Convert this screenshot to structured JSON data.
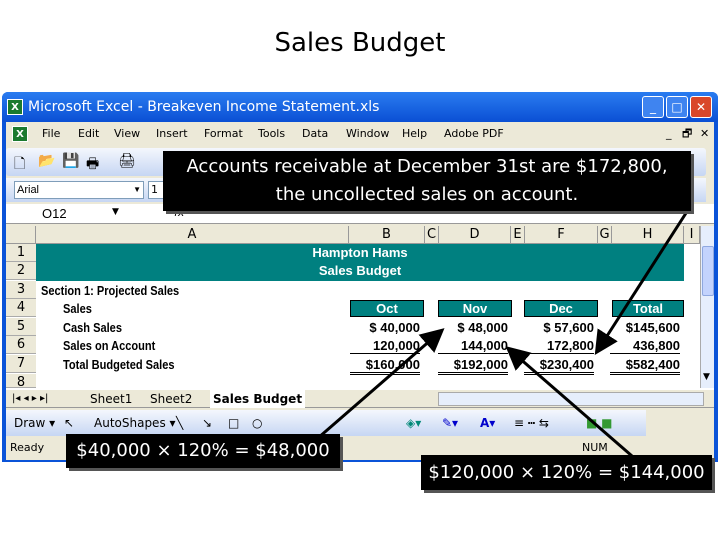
{
  "slide_title": "Sales Budget",
  "window": {
    "title": "Microsoft Excel - Breakeven Income Statement.xls"
  },
  "menu": [
    "File",
    "Edit",
    "View",
    "Insert",
    "Format",
    "Tools",
    "Data",
    "Window",
    "Help",
    "Adobe PDF"
  ],
  "format_bar": {
    "font": "Arial",
    "size": "1"
  },
  "formula_bar": {
    "name_box": "O12",
    "fx": "fx"
  },
  "columns": [
    "A",
    "B",
    "C",
    "D",
    "E",
    "F",
    "G",
    "H",
    "I"
  ],
  "rows": [
    "1",
    "2",
    "3",
    "4",
    "5",
    "6",
    "7",
    "8"
  ],
  "sheet": {
    "company": "Hampton Hams",
    "title": "Sales Budget",
    "section": "Section 1: Projected Sales",
    "labels": [
      "Sales",
      "Cash Sales",
      "Sales on Account",
      "Total Budgeted Sales"
    ],
    "months": [
      "Oct",
      "Nov",
      "Dec",
      "Total"
    ],
    "cash_sales": [
      "$  40,000",
      "$  48,000",
      "$  57,600",
      "$145,600"
    ],
    "sales_on_account": [
      "120,000",
      "144,000",
      "172,800",
      "436,800"
    ],
    "total": [
      "$160,000",
      "$192,000",
      "$230,400",
      "$582,400"
    ]
  },
  "tabs": [
    "Sheet1",
    "Sheet2",
    "Sales Budget"
  ],
  "draw_toolbar": {
    "draw": "Draw ▾",
    "autoshapes": "AutoShapes ▾"
  },
  "status": {
    "ready": "Ready",
    "num": "NUM"
  },
  "callouts": {
    "top_line1": "Accounts receivable at December 31st are $172,800,",
    "top_line2": "the uncollected sales on account.",
    "left": "$40,000 × 120% = $48,000",
    "right": "$120,000 × 120% = $144,000"
  },
  "colors": {
    "teal": "#008080",
    "titlebar": "#0a53d8"
  }
}
